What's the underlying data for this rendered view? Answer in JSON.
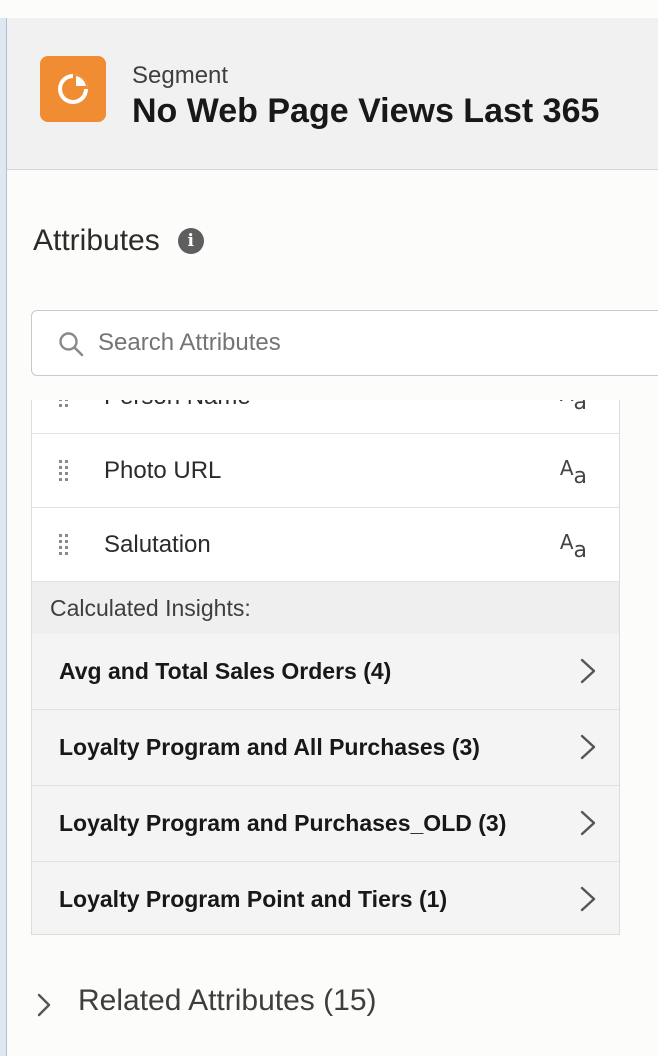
{
  "header": {
    "icon": "segment-pie-icon",
    "kicker": "Segment",
    "title": "No Web Page Views Last 365",
    "accent_color": "#f08d32"
  },
  "attributes": {
    "heading": "Attributes",
    "info_icon": "info-icon",
    "search": {
      "placeholder": "Search Attributes",
      "value": ""
    },
    "items": [
      {
        "label": "Person Name",
        "type_icon": "text-type-icon",
        "partial": true
      },
      {
        "label": "Photo URL",
        "type_icon": "text-type-icon"
      },
      {
        "label": "Salutation",
        "type_icon": "text-type-icon"
      }
    ],
    "type_glyph_upper": "A",
    "type_glyph_lower": "a",
    "calculated_insights": {
      "label": "Calculated Insights:",
      "items": [
        {
          "label": "Avg and Total Sales Orders (4)"
        },
        {
          "label": "Loyalty Program and All Purchases (3)"
        },
        {
          "label": "Loyalty Program and Purchases_OLD (3)"
        },
        {
          "label": "Loyalty Program Point and Tiers (1)"
        }
      ]
    }
  },
  "related": {
    "label": "Related Attributes (15)"
  }
}
